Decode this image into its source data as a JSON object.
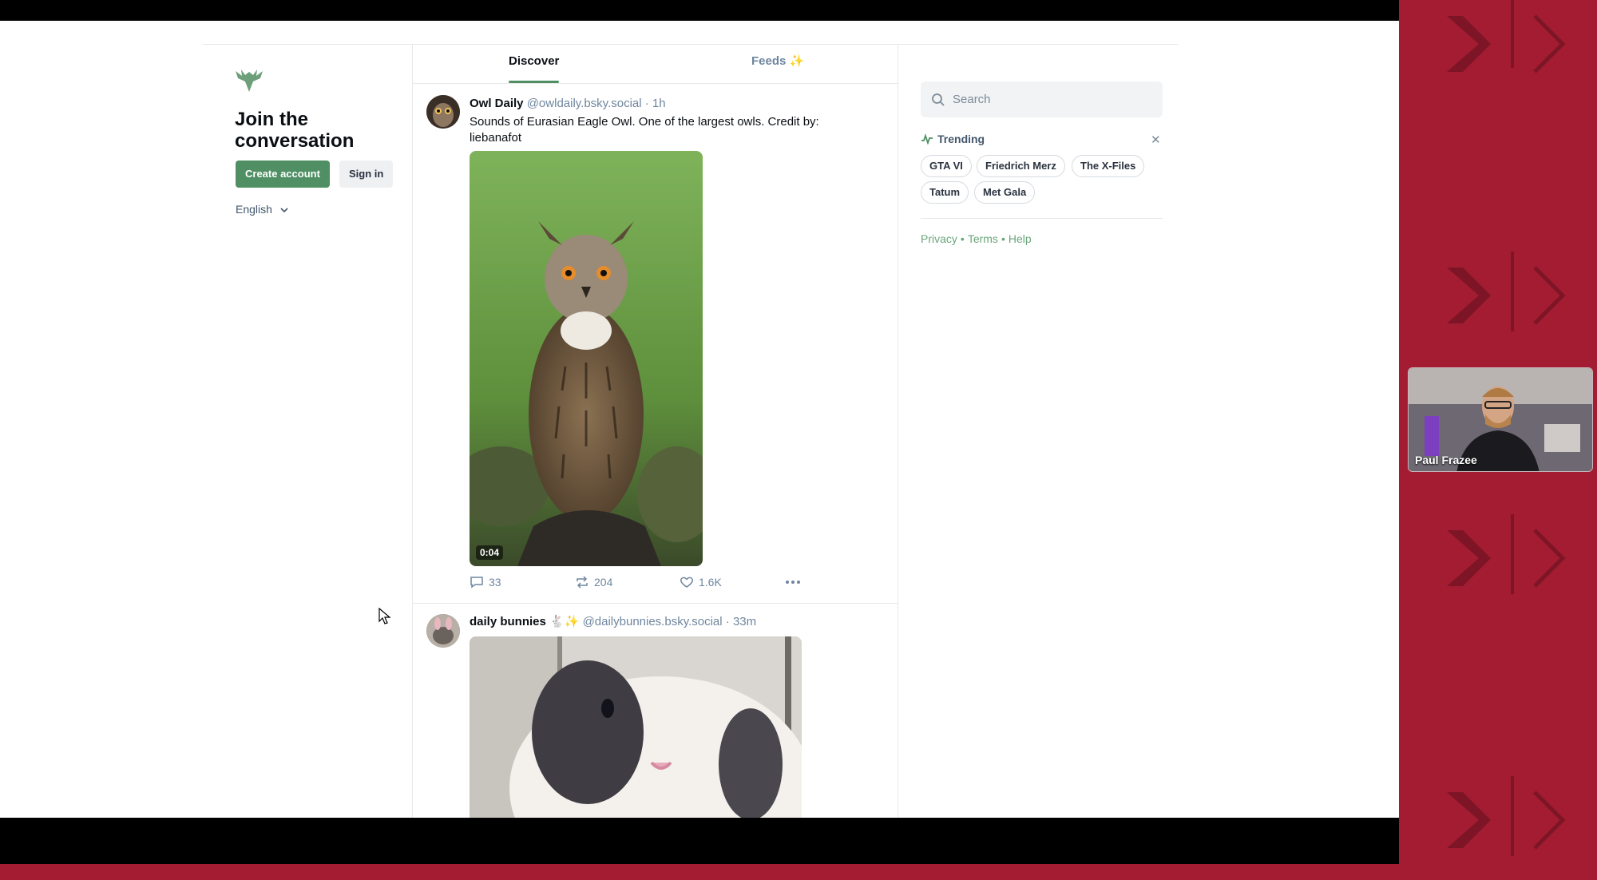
{
  "sidebar": {
    "title": "Join the conversation",
    "create_account": "Create account",
    "sign_in": "Sign in",
    "language": "English"
  },
  "tabs": [
    {
      "label": "Discover",
      "active": true
    },
    {
      "label": "Feeds ✨",
      "active": false
    }
  ],
  "posts": [
    {
      "name": "Owl Daily",
      "handle": "@owldaily.bsky.social",
      "time": "· 1h",
      "text": "Sounds of Eurasian Eagle Owl. One of the largest owls. Credit by: liebanafot",
      "media_icon": "video-thumbnail-owl",
      "video_time": "0:04",
      "replies": "33",
      "reposts": "204",
      "likes": "1.6K"
    },
    {
      "name": "daily bunnies",
      "name_suffix": "🐇✨",
      "handle": "@dailybunnies.bsky.social",
      "time": "· 33m",
      "media_icon": "image-bunny"
    }
  ],
  "search": {
    "placeholder": "Search"
  },
  "trending": {
    "title": "Trending",
    "items": [
      "GTA VI",
      "Friedrich Merz",
      "The X-Files",
      "Tatum",
      "Met Gala"
    ]
  },
  "footer_links": [
    "Privacy",
    "Terms",
    "Help"
  ],
  "webcam": {
    "name": "Paul Frazee"
  },
  "colors": {
    "brand_green": "#4f8f63",
    "link_green": "#6aa57a",
    "muted": "#6f869f",
    "background_red": "#a31c31"
  }
}
